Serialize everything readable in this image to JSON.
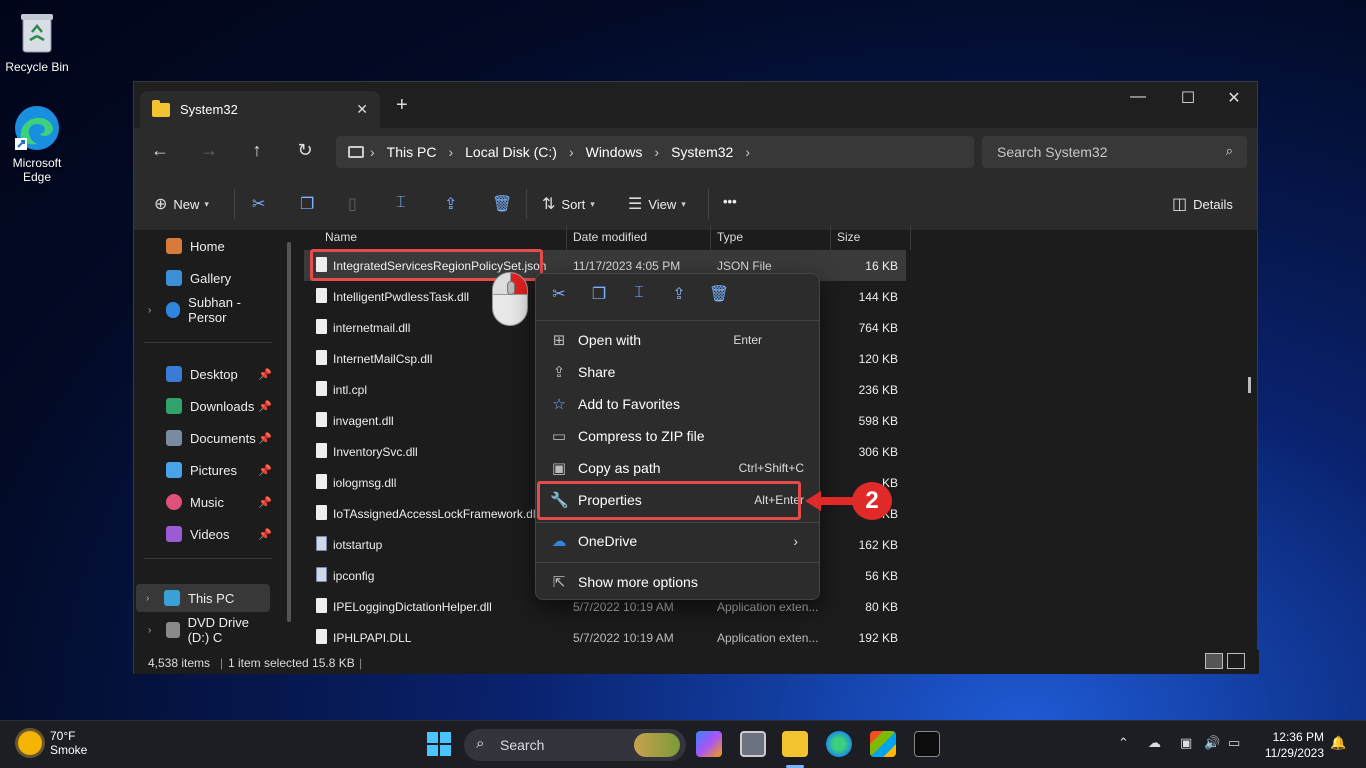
{
  "desktop": {
    "icons": [
      {
        "label": "Recycle Bin"
      },
      {
        "label": "Microsoft Edge"
      }
    ]
  },
  "window": {
    "tab_title": "System32",
    "tab_close": "✕",
    "new_tab": "+",
    "controls": {
      "minimize": "—",
      "maximize": "☐",
      "close": "✕"
    }
  },
  "nav": {
    "back": "←",
    "forward": "→",
    "up": "↑",
    "refresh": "↻",
    "breadcrumb": [
      "This PC",
      "Local Disk (C:)",
      "Windows",
      "System32"
    ],
    "search_placeholder": "Search System32"
  },
  "commandbar": {
    "new": "New",
    "sort": "Sort",
    "view": "View",
    "more": "•••",
    "details": "Details"
  },
  "sidebar": {
    "items": [
      {
        "label": "Home"
      },
      {
        "label": "Gallery"
      },
      {
        "label": "Subhan - Persor"
      },
      {
        "label": "Desktop"
      },
      {
        "label": "Downloads"
      },
      {
        "label": "Documents"
      },
      {
        "label": "Pictures"
      },
      {
        "label": "Music"
      },
      {
        "label": "Videos"
      },
      {
        "label": "This PC"
      },
      {
        "label": "DVD Drive (D:) C"
      }
    ]
  },
  "columns": {
    "name": "Name",
    "date": "Date modified",
    "type": "Type",
    "size": "Size"
  },
  "files": [
    {
      "name": "IntegratedServicesRegionPolicySet.json",
      "date": "11/17/2023 4:05 PM",
      "type": "JSON File",
      "size": "16 KB"
    },
    {
      "name": "IntelligentPwdlessTask.dll",
      "date": "",
      "type": "",
      "size": "144 KB"
    },
    {
      "name": "internetmail.dll",
      "date": "",
      "type": "",
      "size": "764 KB"
    },
    {
      "name": "InternetMailCsp.dll",
      "date": "",
      "type": "",
      "size": "120 KB"
    },
    {
      "name": "intl.cpl",
      "date": "",
      "type": "",
      "size": "236 KB"
    },
    {
      "name": "invagent.dll",
      "date": "",
      "type": "",
      "size": "598 KB"
    },
    {
      "name": "InventorySvc.dll",
      "date": "",
      "type": "",
      "size": "306 KB"
    },
    {
      "name": "iologmsg.dll",
      "date": "",
      "type": "",
      "size": "KB"
    },
    {
      "name": "IoTAssignedAccessLockFramework.dll",
      "date": "",
      "type": "",
      "size": "KB"
    },
    {
      "name": "iotstartup",
      "date": "",
      "type": "",
      "size": "162 KB"
    },
    {
      "name": "ipconfig",
      "date": "",
      "type": "",
      "size": "56 KB"
    },
    {
      "name": "IPELoggingDictationHelper.dll",
      "date": "5/7/2022 10:19 AM",
      "type": "Application exten...",
      "size": "80 KB"
    },
    {
      "name": "IPHLPAPI.DLL",
      "date": "5/7/2022 10:19 AM",
      "type": "Application exten...",
      "size": "192 KB"
    }
  ],
  "status": {
    "count": "4,538 items",
    "selected": "1 item selected  15.8 KB"
  },
  "context_menu": {
    "items": [
      {
        "label": "Open with",
        "shortcut": "Enter"
      },
      {
        "label": "Share",
        "shortcut": ""
      },
      {
        "label": "Add to Favorites",
        "shortcut": ""
      },
      {
        "label": "Compress to ZIP file",
        "shortcut": ""
      },
      {
        "label": "Copy as path",
        "shortcut": "Ctrl+Shift+C"
      },
      {
        "label": "Properties",
        "shortcut": "Alt+Enter"
      },
      {
        "label": "OneDrive",
        "shortcut": ""
      },
      {
        "label": "Show more options",
        "shortcut": ""
      }
    ],
    "submenu_arrow": "›"
  },
  "annotation": {
    "step": "2",
    "highlight_color": "#e54b4b"
  },
  "taskbar": {
    "weather_temp": "70°F",
    "weather_desc": "Smoke",
    "search_label": "Search",
    "time": "12:36 PM",
    "date": "11/29/2023"
  },
  "colors": {
    "accent": "#7bb3ff",
    "annotation_red": "#e02a2a"
  }
}
